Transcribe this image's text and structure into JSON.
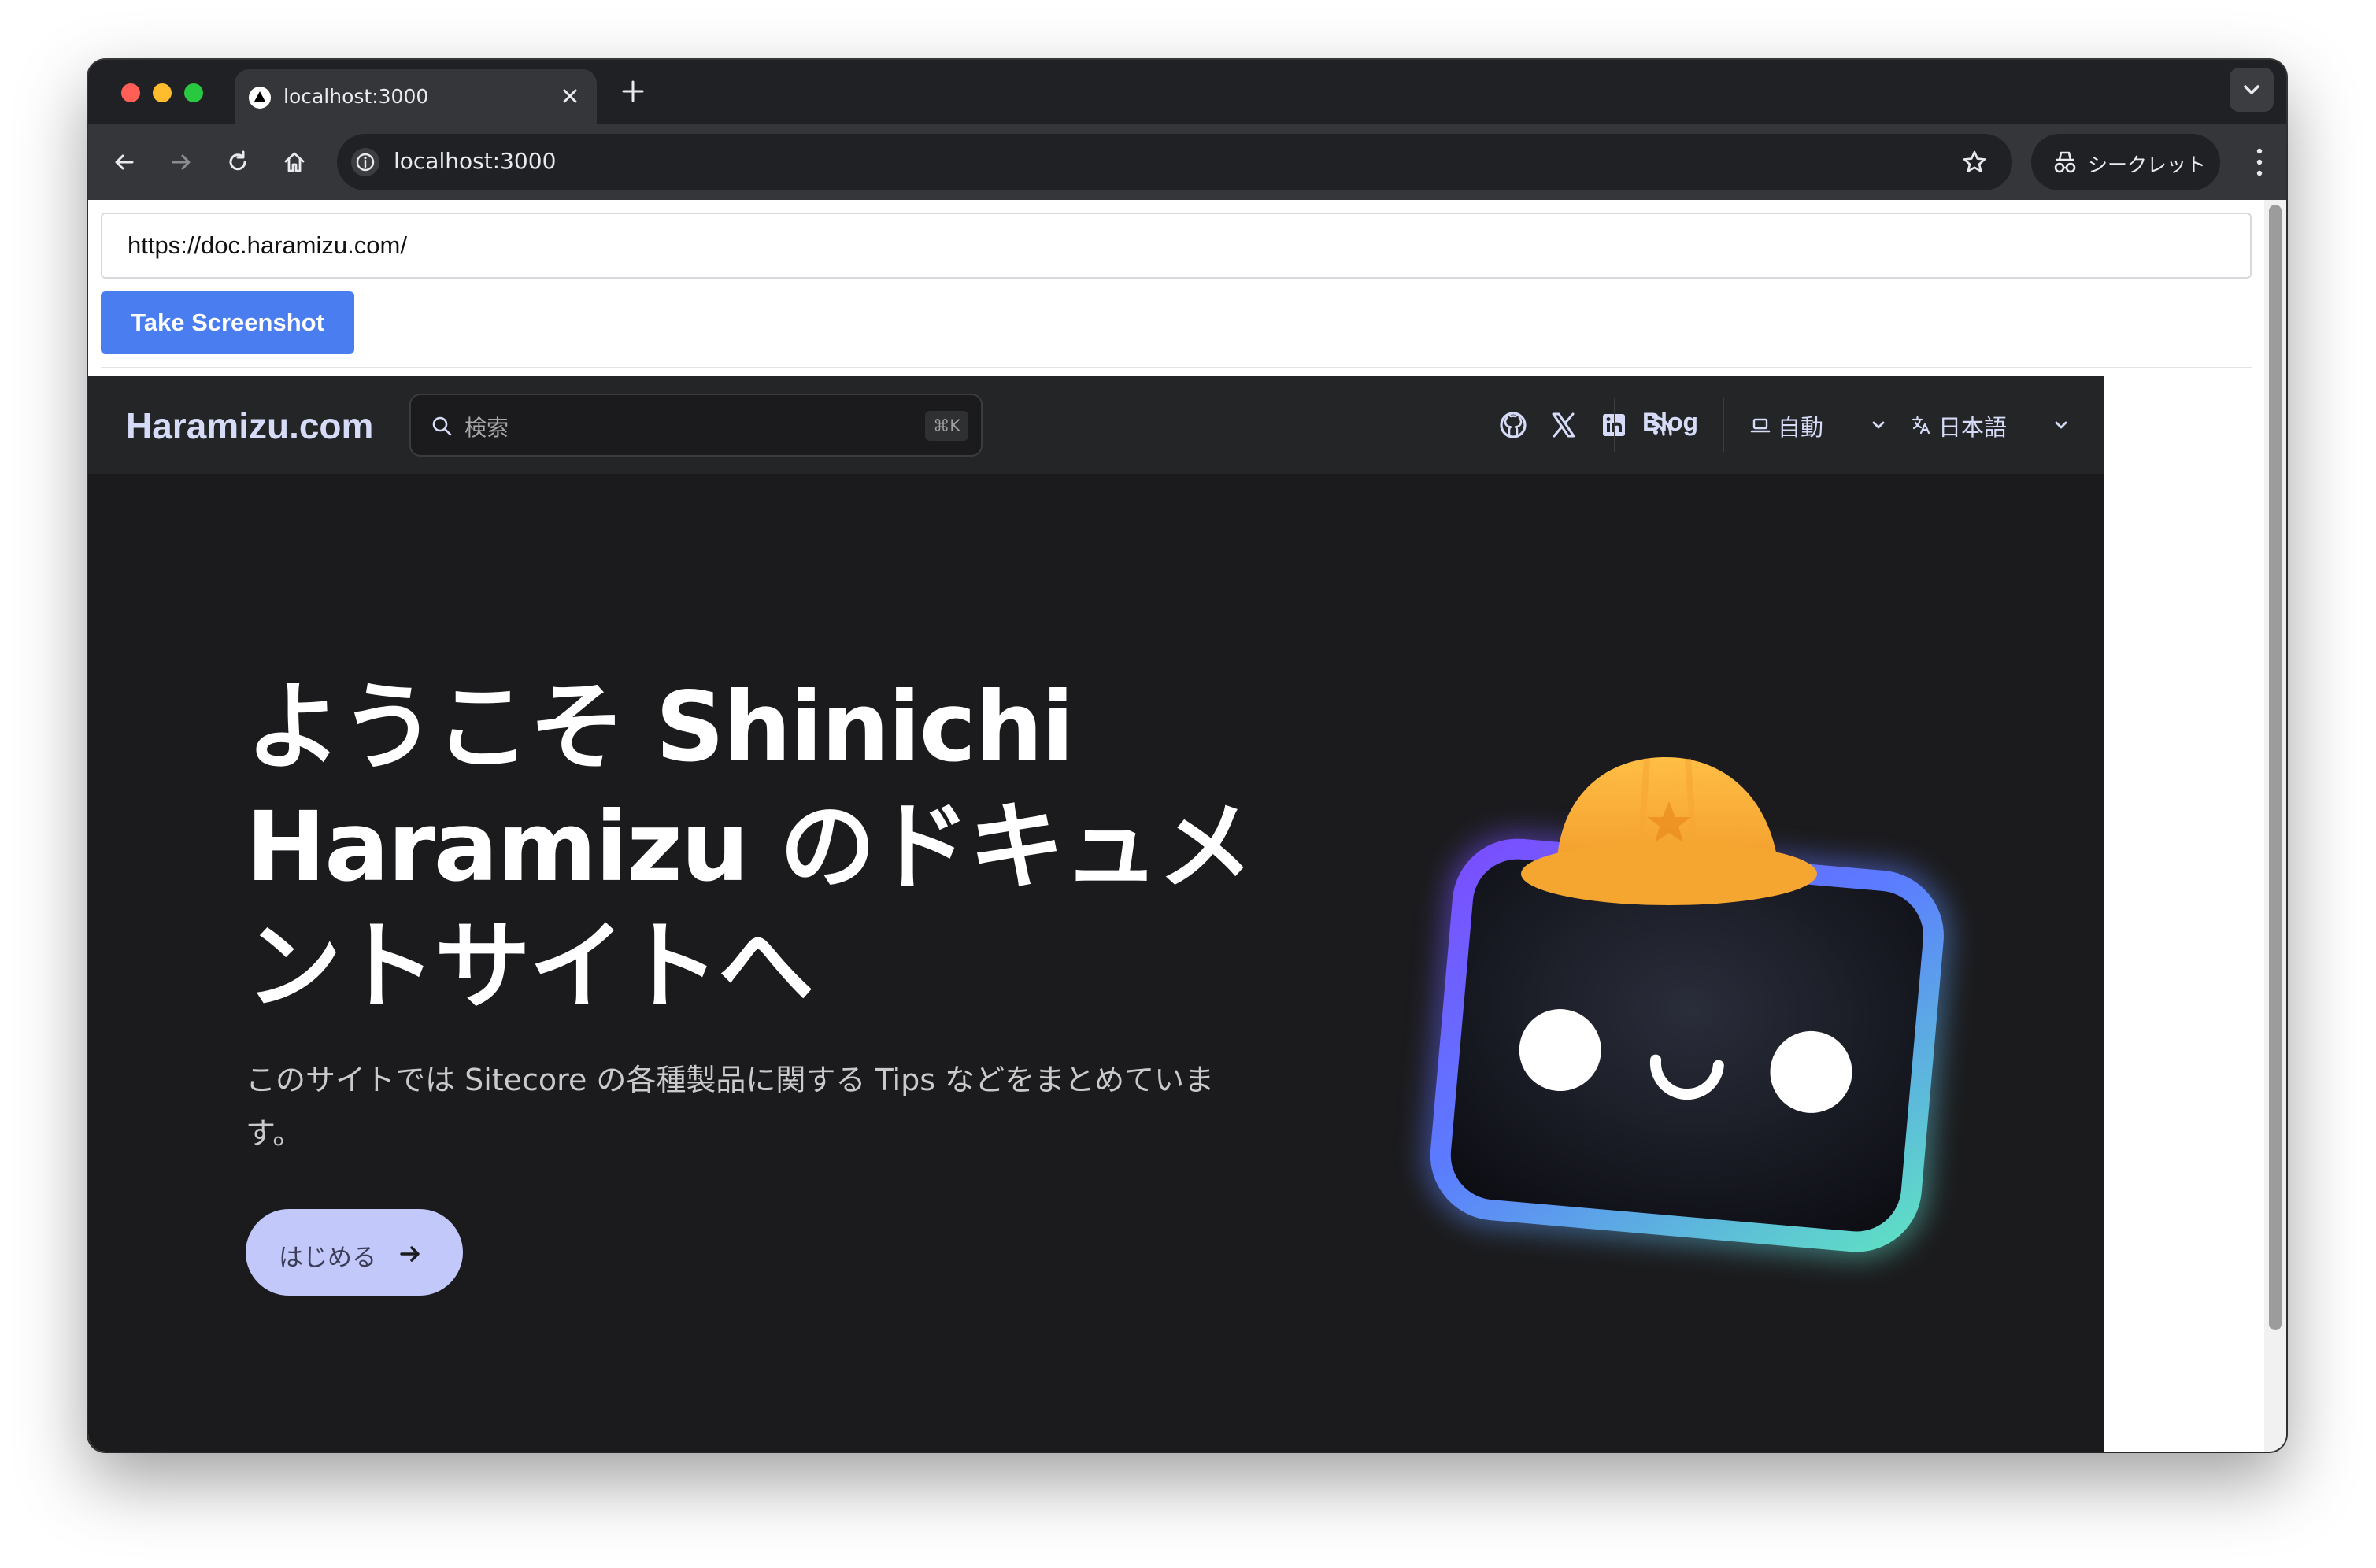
{
  "browser": {
    "tab": {
      "title": "localhost:3000"
    },
    "address": "localhost:3000",
    "incognito_label": "シークレット"
  },
  "tool": {
    "url_value": "https://doc.haramizu.com/",
    "button_label": "Take Screenshot"
  },
  "site": {
    "logo": "Haramizu.com",
    "search_placeholder": "検索",
    "search_shortcut": "⌘K",
    "nav": {
      "blog": "Blog",
      "theme": "自動",
      "language": "日本語"
    },
    "hero": {
      "title": "ようこそ Shinichi Haramizu のドキュメントサイトへ",
      "subtitle": "このサイトでは Sitecore の各種製品に関する Tips などをまとめています。",
      "cta": "はじめる"
    }
  },
  "colors": {
    "button_blue": "#4a7ef0",
    "site_bg": "#1b1b1d",
    "cta_bg": "#c3c8fa",
    "logo_text": "#d6dcf8"
  }
}
